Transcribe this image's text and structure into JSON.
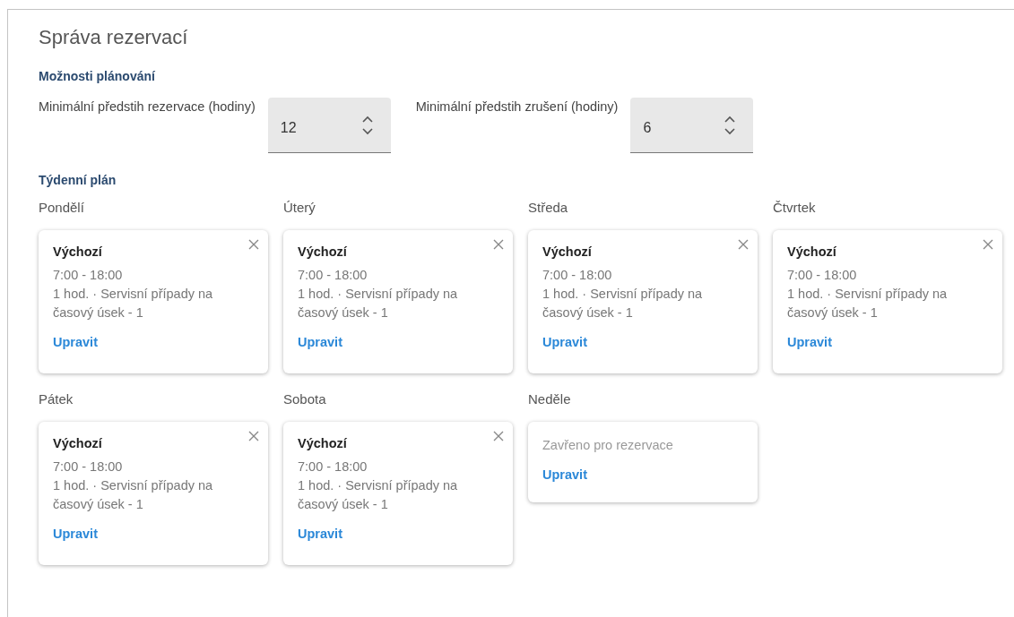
{
  "title": "Správa rezervací",
  "scheduling": {
    "heading": "Možnosti plánování",
    "fields": [
      {
        "label": "Minimální předstih rezervace (hodiny)",
        "value": "12"
      },
      {
        "label": "Minimální předstih zrušení (hodiny)",
        "value": "6"
      }
    ]
  },
  "weekly": {
    "heading": "Týdenní plán",
    "days": [
      {
        "day": "Pondělí",
        "kind": "schedule",
        "name": "Výchozí",
        "hours": "7:00 - 18:00",
        "detail": "1 hod. · Servisní případy na časový úsek - 1",
        "action": "Upravit"
      },
      {
        "day": "Úterý",
        "kind": "schedule",
        "name": "Výchozí",
        "hours": "7:00 - 18:00",
        "detail": "1 hod. · Servisní případy na časový úsek - 1",
        "action": "Upravit"
      },
      {
        "day": "Středa",
        "kind": "schedule",
        "name": "Výchozí",
        "hours": "7:00 - 18:00",
        "detail": "1 hod. · Servisní případy na časový úsek - 1",
        "action": "Upravit"
      },
      {
        "day": "Čtvrtek",
        "kind": "schedule",
        "name": "Výchozí",
        "hours": "7:00 - 18:00",
        "detail": "1 hod. · Servisní případy na časový úsek - 1",
        "action": "Upravit"
      },
      {
        "day": "Pátek",
        "kind": "schedule",
        "name": "Výchozí",
        "hours": "7:00 - 18:00",
        "detail": "1 hod. · Servisní případy na časový úsek - 1",
        "action": "Upravit"
      },
      {
        "day": "Sobota",
        "kind": "schedule",
        "name": "Výchozí",
        "hours": "7:00 - 18:00",
        "detail": "1 hod. · Servisní případy na časový úsek - 1",
        "action": "Upravit"
      },
      {
        "day": "Neděle",
        "kind": "closed",
        "note": "Zavřeno pro rezervace",
        "action": "Upravit"
      }
    ]
  }
}
